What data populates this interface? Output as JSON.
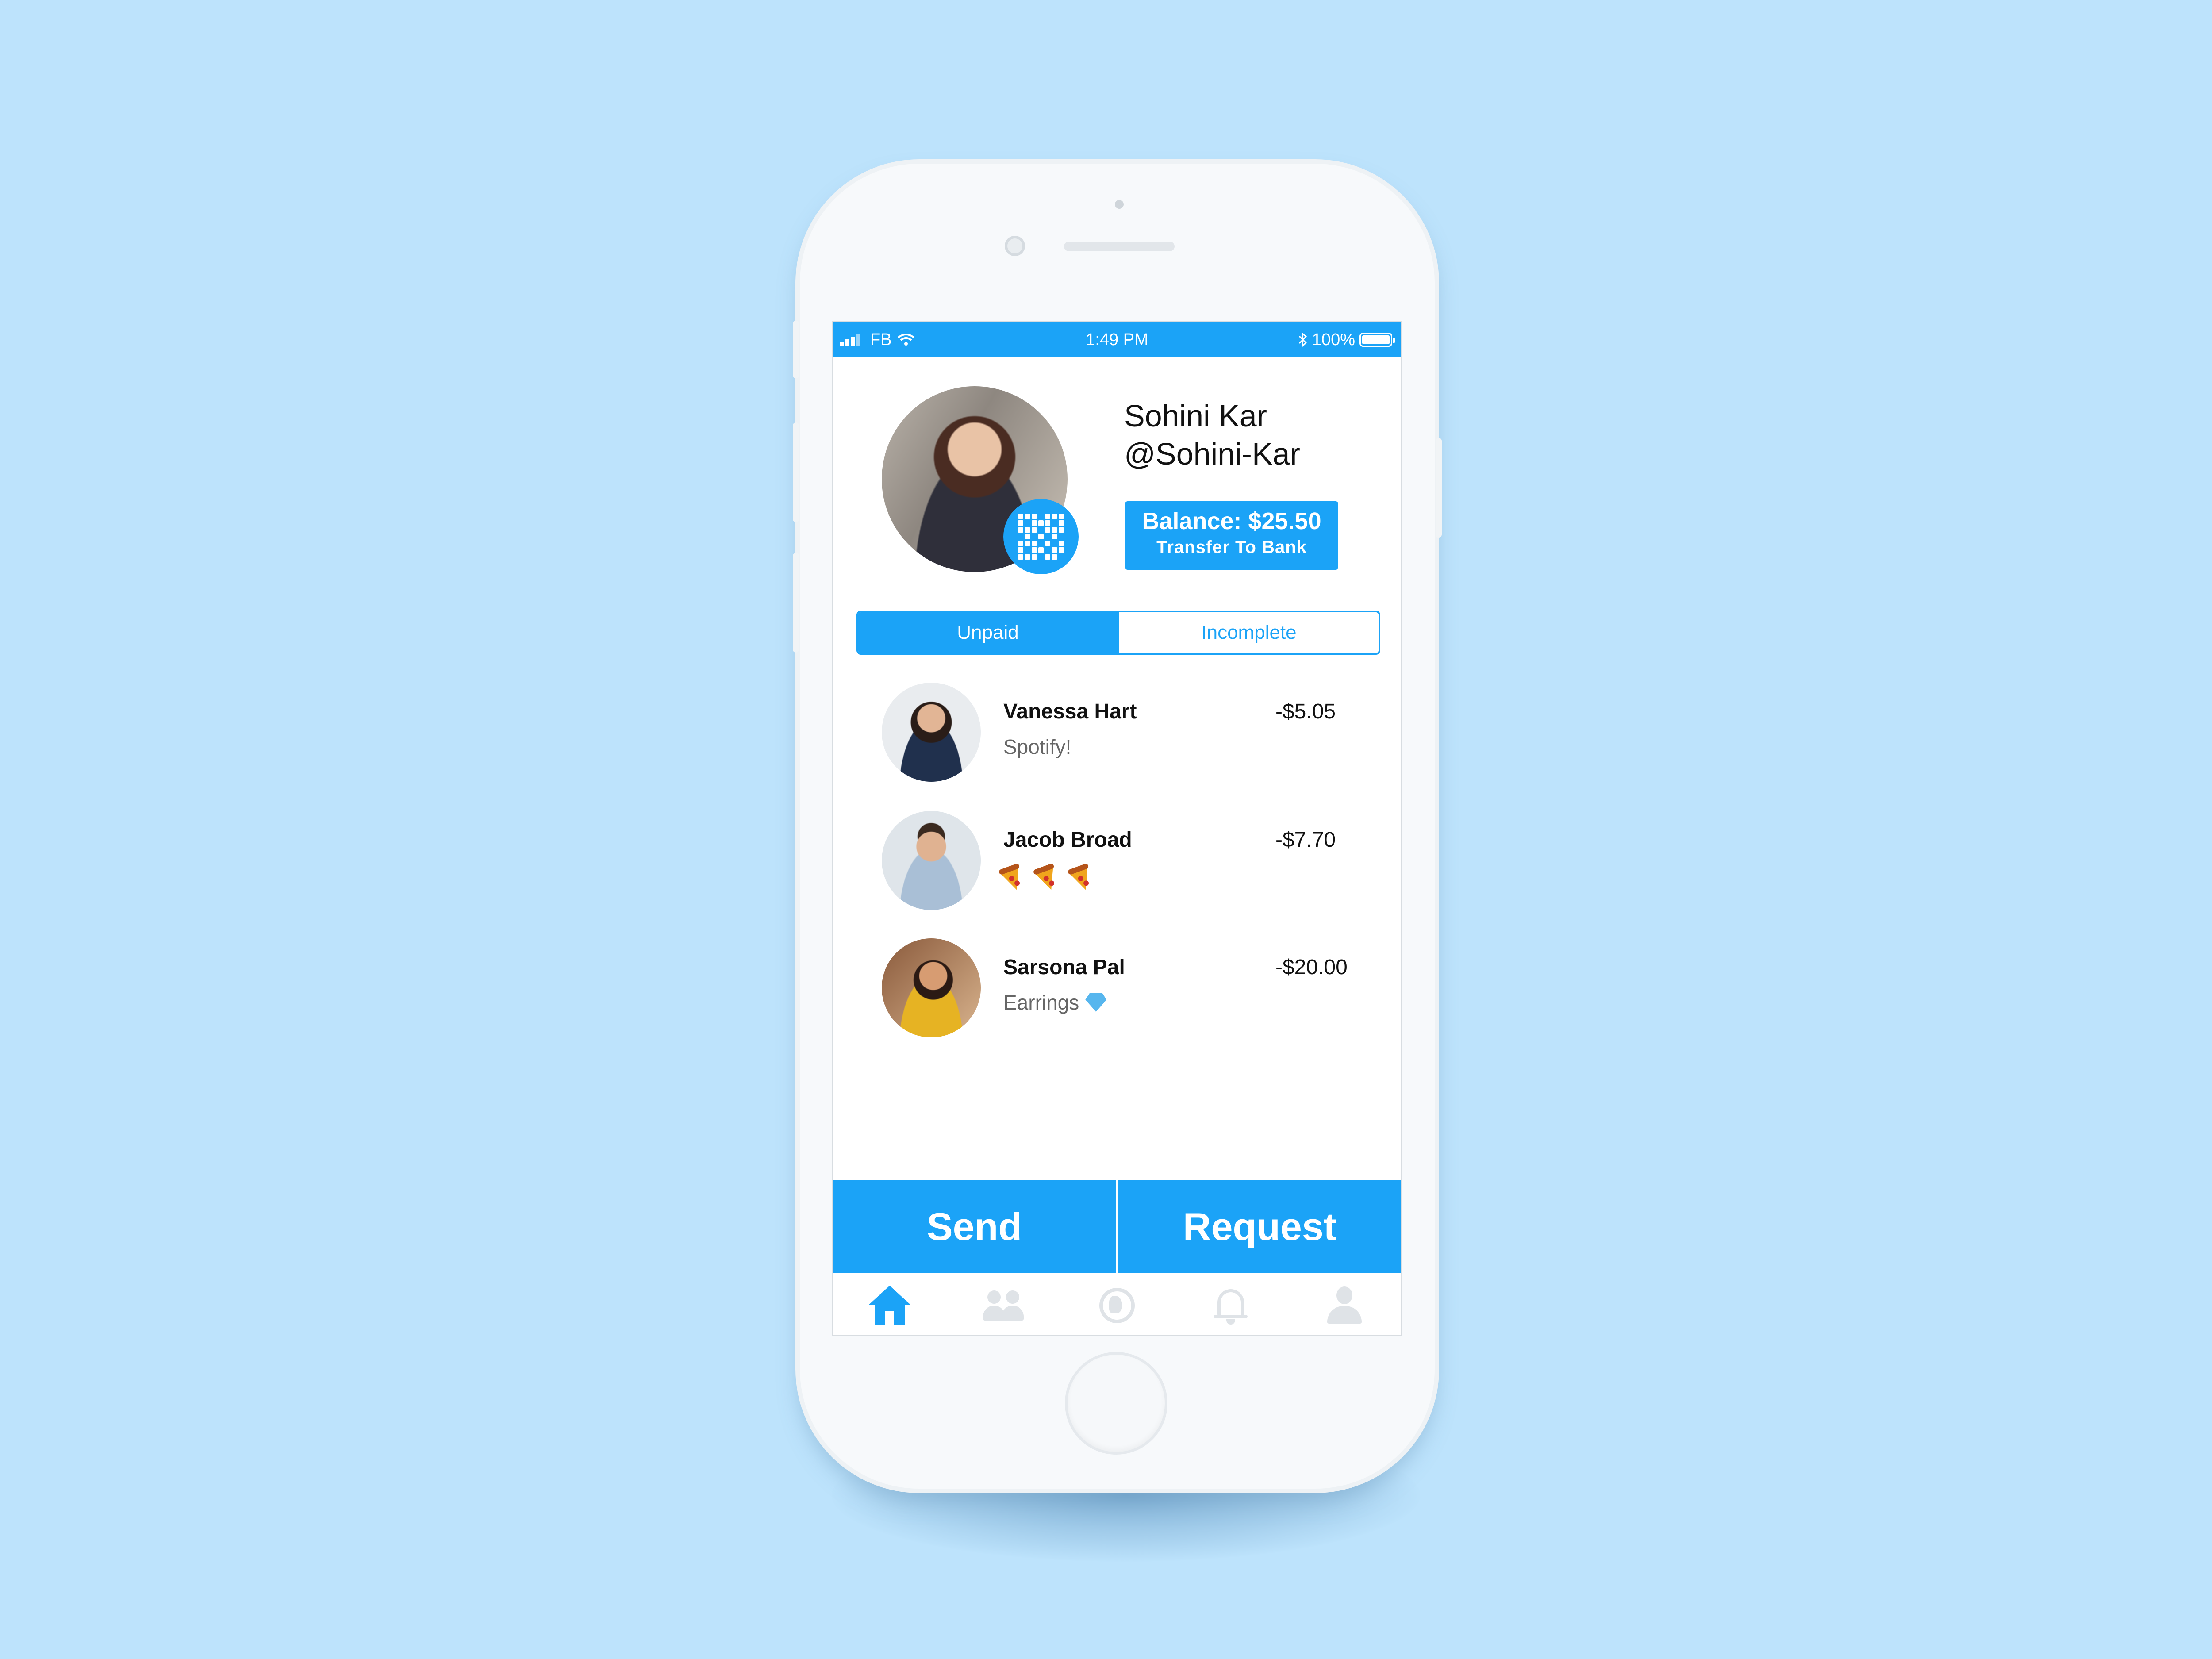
{
  "status_bar": {
    "carrier": "FB",
    "time": "1:49 PM",
    "battery": "100%",
    "battery_level": 1.0
  },
  "profile": {
    "name": "Sohini Kar",
    "handle": "@Sohini-Kar",
    "balance_label": "Balance: $25.50",
    "transfer_label": "Transfer To Bank"
  },
  "tabs": [
    {
      "label": "Unpaid",
      "active": true
    },
    {
      "label": "Incomplete",
      "active": false
    }
  ],
  "transactions": [
    {
      "name": "Vanessa Hart",
      "memo": "Spotify!",
      "amount": "-$5.05"
    },
    {
      "name": "Jacob Broad",
      "memo": "",
      "memo_icon": "pizza-emoji x3",
      "amount": "-$7.70"
    },
    {
      "name": "Sarsona Pal",
      "memo": "Earrings",
      "memo_icon": "gem-emoji",
      "amount": "-$20.00"
    }
  ],
  "actions": {
    "send": "Send",
    "request": "Request"
  },
  "nav_icons": [
    "home-icon",
    "friends-icon",
    "globe-icon",
    "bell-icon",
    "user-icon"
  ],
  "colors": {
    "accent": "#1ba3f7",
    "background": "#bde3fc",
    "inactive_icon": "#dfe3e7"
  }
}
